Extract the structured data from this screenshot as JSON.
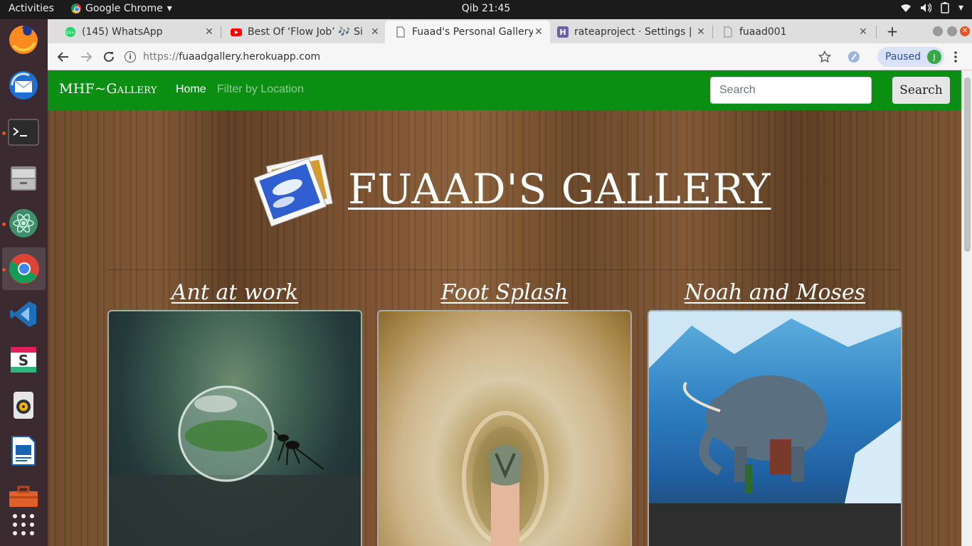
{
  "desktop": {
    "activities": "Activities",
    "app_name": "Google Chrome",
    "clock": "Qib 21:45"
  },
  "dock": {
    "items": [
      "firefox-icon",
      "thunderbird-icon",
      "terminal-icon",
      "files-icon",
      "atom-icon",
      "chrome-icon",
      "vscode-icon",
      "slack-icon",
      "rhythmbox-icon",
      "libreoffice-impress-icon",
      "toolbox-icon",
      "app-grid-icon"
    ]
  },
  "browser": {
    "tabs": [
      {
        "label": "(145) WhatsApp",
        "icon": "whatsapp-icon",
        "active": false
      },
      {
        "label": "Best Of ‘Flow Job’ 🎶 Si",
        "icon": "youtube-icon",
        "active": false
      },
      {
        "label": "Fuaad's Personal Gallery",
        "icon": "page-icon",
        "active": true
      },
      {
        "label": "rateaproject · Settings | ",
        "icon": "heroku-icon",
        "active": false
      },
      {
        "label": "fuaad001",
        "icon": "page-icon",
        "active": false
      }
    ],
    "url_protocol": "https://",
    "url_host": "fuaadgallery.herokuapp.com",
    "profile_status": "Paused",
    "profile_initial": "J"
  },
  "site": {
    "brand": "MHF~Gallery",
    "nav_home": "Home",
    "nav_filter": "Filter by Location",
    "search_placeholder": "Search",
    "search_button": "Search",
    "hero_title": "FUAAD'S GALLERY",
    "photos": [
      {
        "title": "Ant at work"
      },
      {
        "title": "Foot Splash"
      },
      {
        "title": "Noah and Moses"
      }
    ],
    "colors": {
      "navbar": "#0b8f12",
      "wood": "#6e4a2a"
    }
  }
}
